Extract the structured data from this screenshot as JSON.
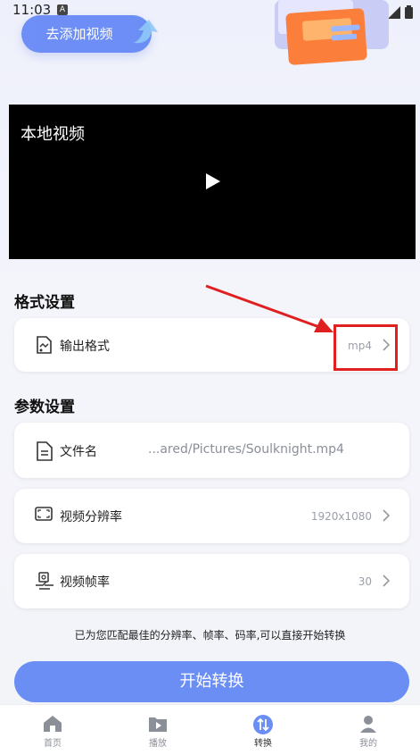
{
  "status_bar": {
    "time": "11:03",
    "notification_letter": "A"
  },
  "header": {
    "add_video_label": "去添加视频"
  },
  "player": {
    "title": "本地视频"
  },
  "format_section": {
    "title": "格式设置",
    "output_format": {
      "label": "输出格式",
      "value": "mp4"
    }
  },
  "params_section": {
    "title": "参数设置",
    "file_name": {
      "label": "文件名",
      "value": "...ared/Pictures/Soulknight.mp4"
    },
    "resolution": {
      "label": "视频分辨率",
      "value": "1920x1080"
    },
    "frame_rate": {
      "label": "视频帧率",
      "value": "30"
    }
  },
  "hint": "已为您匹配最佳的分辨率、帧率、码率,可以直接开始转换",
  "start_button": "开始转换",
  "tabs": [
    {
      "label": "首页",
      "icon": "home-icon"
    },
    {
      "label": "播放",
      "icon": "play-folder-icon"
    },
    {
      "label": "转换",
      "icon": "convert-icon",
      "active": true
    },
    {
      "label": "我的",
      "icon": "user-icon"
    }
  ],
  "colors": {
    "accent": "#6b8ef5",
    "annotation": "#e02020",
    "player_bg": "#000000"
  }
}
